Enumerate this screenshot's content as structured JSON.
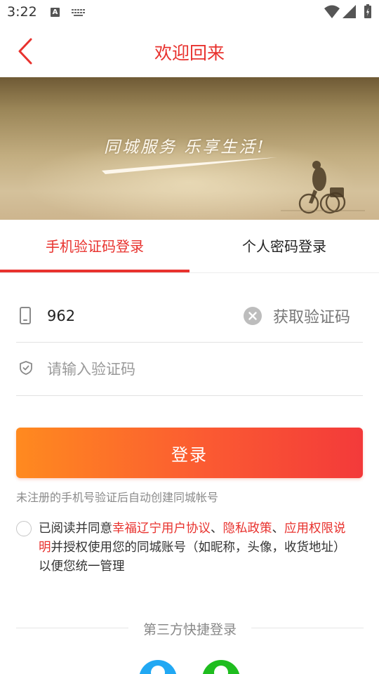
{
  "status_bar": {
    "time": "3:22",
    "notification_icon_letter": "A",
    "icons": [
      "keyboard-icon",
      "wifi-icon",
      "signal-icon",
      "battery-icon"
    ]
  },
  "header": {
    "title": "欢迎回来",
    "back_icon": "chevron-left-icon",
    "title_color": "#e8322e"
  },
  "banner": {
    "slogan": "同城服务 乐享生活!"
  },
  "tabs": [
    {
      "label": "手机验证码登录",
      "active": true
    },
    {
      "label": "个人密码登录",
      "active": false
    }
  ],
  "form": {
    "phone_value": "962",
    "phone_icon": "phone-icon",
    "clear_icon": "clear-icon",
    "get_code_label": "获取验证码",
    "code_placeholder": "请输入验证码",
    "code_icon": "shield-icon"
  },
  "login_button": {
    "label": "登录",
    "gradient": [
      "#ff8a1f",
      "#f33a3a"
    ]
  },
  "hint": "未注册的手机号验证后自动创建同城帐号",
  "agreement": {
    "checked": false,
    "prefix": "已阅读并同意",
    "link1": "幸福辽宁用户协议",
    "sep1": "、",
    "link2": "隐私政策",
    "sep2": "、",
    "link3": "应用权限说明",
    "suffix": "并授权使用您的同城账号（如昵称，头像，收货地址）以便您统一管理"
  },
  "third_party": {
    "label": "第三方快捷登录",
    "providers": [
      {
        "icon": "qq-icon",
        "color": "#21a8f3"
      },
      {
        "icon": "wechat-icon",
        "color": "#1fbd1f"
      }
    ]
  },
  "colors": {
    "accent": "#e8322e"
  }
}
